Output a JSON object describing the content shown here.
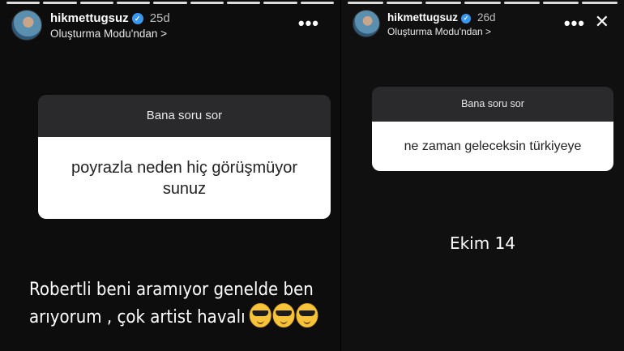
{
  "left_story": {
    "progress": {
      "segments": 9,
      "completed": 9
    },
    "username": "hikmettugsuz",
    "time_ago": "25d",
    "subtitle": "Oluşturma Modu'ndan >",
    "menu": "•••",
    "question_title": "Bana soru sor",
    "question_text": "poyrazla neden hiç görüşmüyor sunuz",
    "caption_line1": "Robertli beni aramıyor genelde ben",
    "caption_line2": "arıyorum , çok artist havalı",
    "caption_emojis": "😎😎😎"
  },
  "right_story": {
    "progress": {
      "segments": 7,
      "completed": 7
    },
    "username": "hikmettugsuz",
    "time_ago": "26d",
    "subtitle": "Oluşturma Modu'ndan >",
    "menu": "•••",
    "close": "✕",
    "question_title": "Bana soru sor",
    "question_text": "ne zaman geleceksin türkiyeye",
    "note": "Ekim 14"
  },
  "colors": {
    "verified": "#3897f0",
    "question_header": "#2a2a2c",
    "question_body": "#ffffff"
  }
}
